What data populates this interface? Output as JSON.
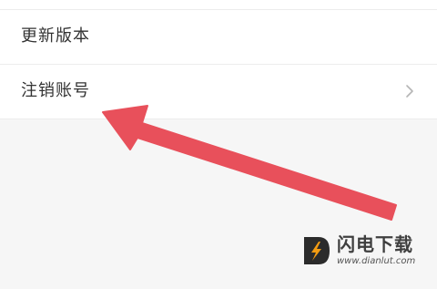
{
  "settings": {
    "items": [
      {
        "label": "更新版本",
        "has_chevron": false
      },
      {
        "label": "注销账号",
        "has_chevron": true
      }
    ]
  },
  "annotation": {
    "arrow_color": "#e8505b",
    "arrow_target": "注销账号"
  },
  "watermark": {
    "title": "闪电下载",
    "url": "www.dianlut.com",
    "logo_color": "#f39c12",
    "logo_bg": "#2b2b2b"
  },
  "colors": {
    "page_bg": "#f6f6f6",
    "row_bg": "#ffffff",
    "text": "#333333",
    "divider": "#ececec",
    "chevron": "#b5b5b5"
  }
}
